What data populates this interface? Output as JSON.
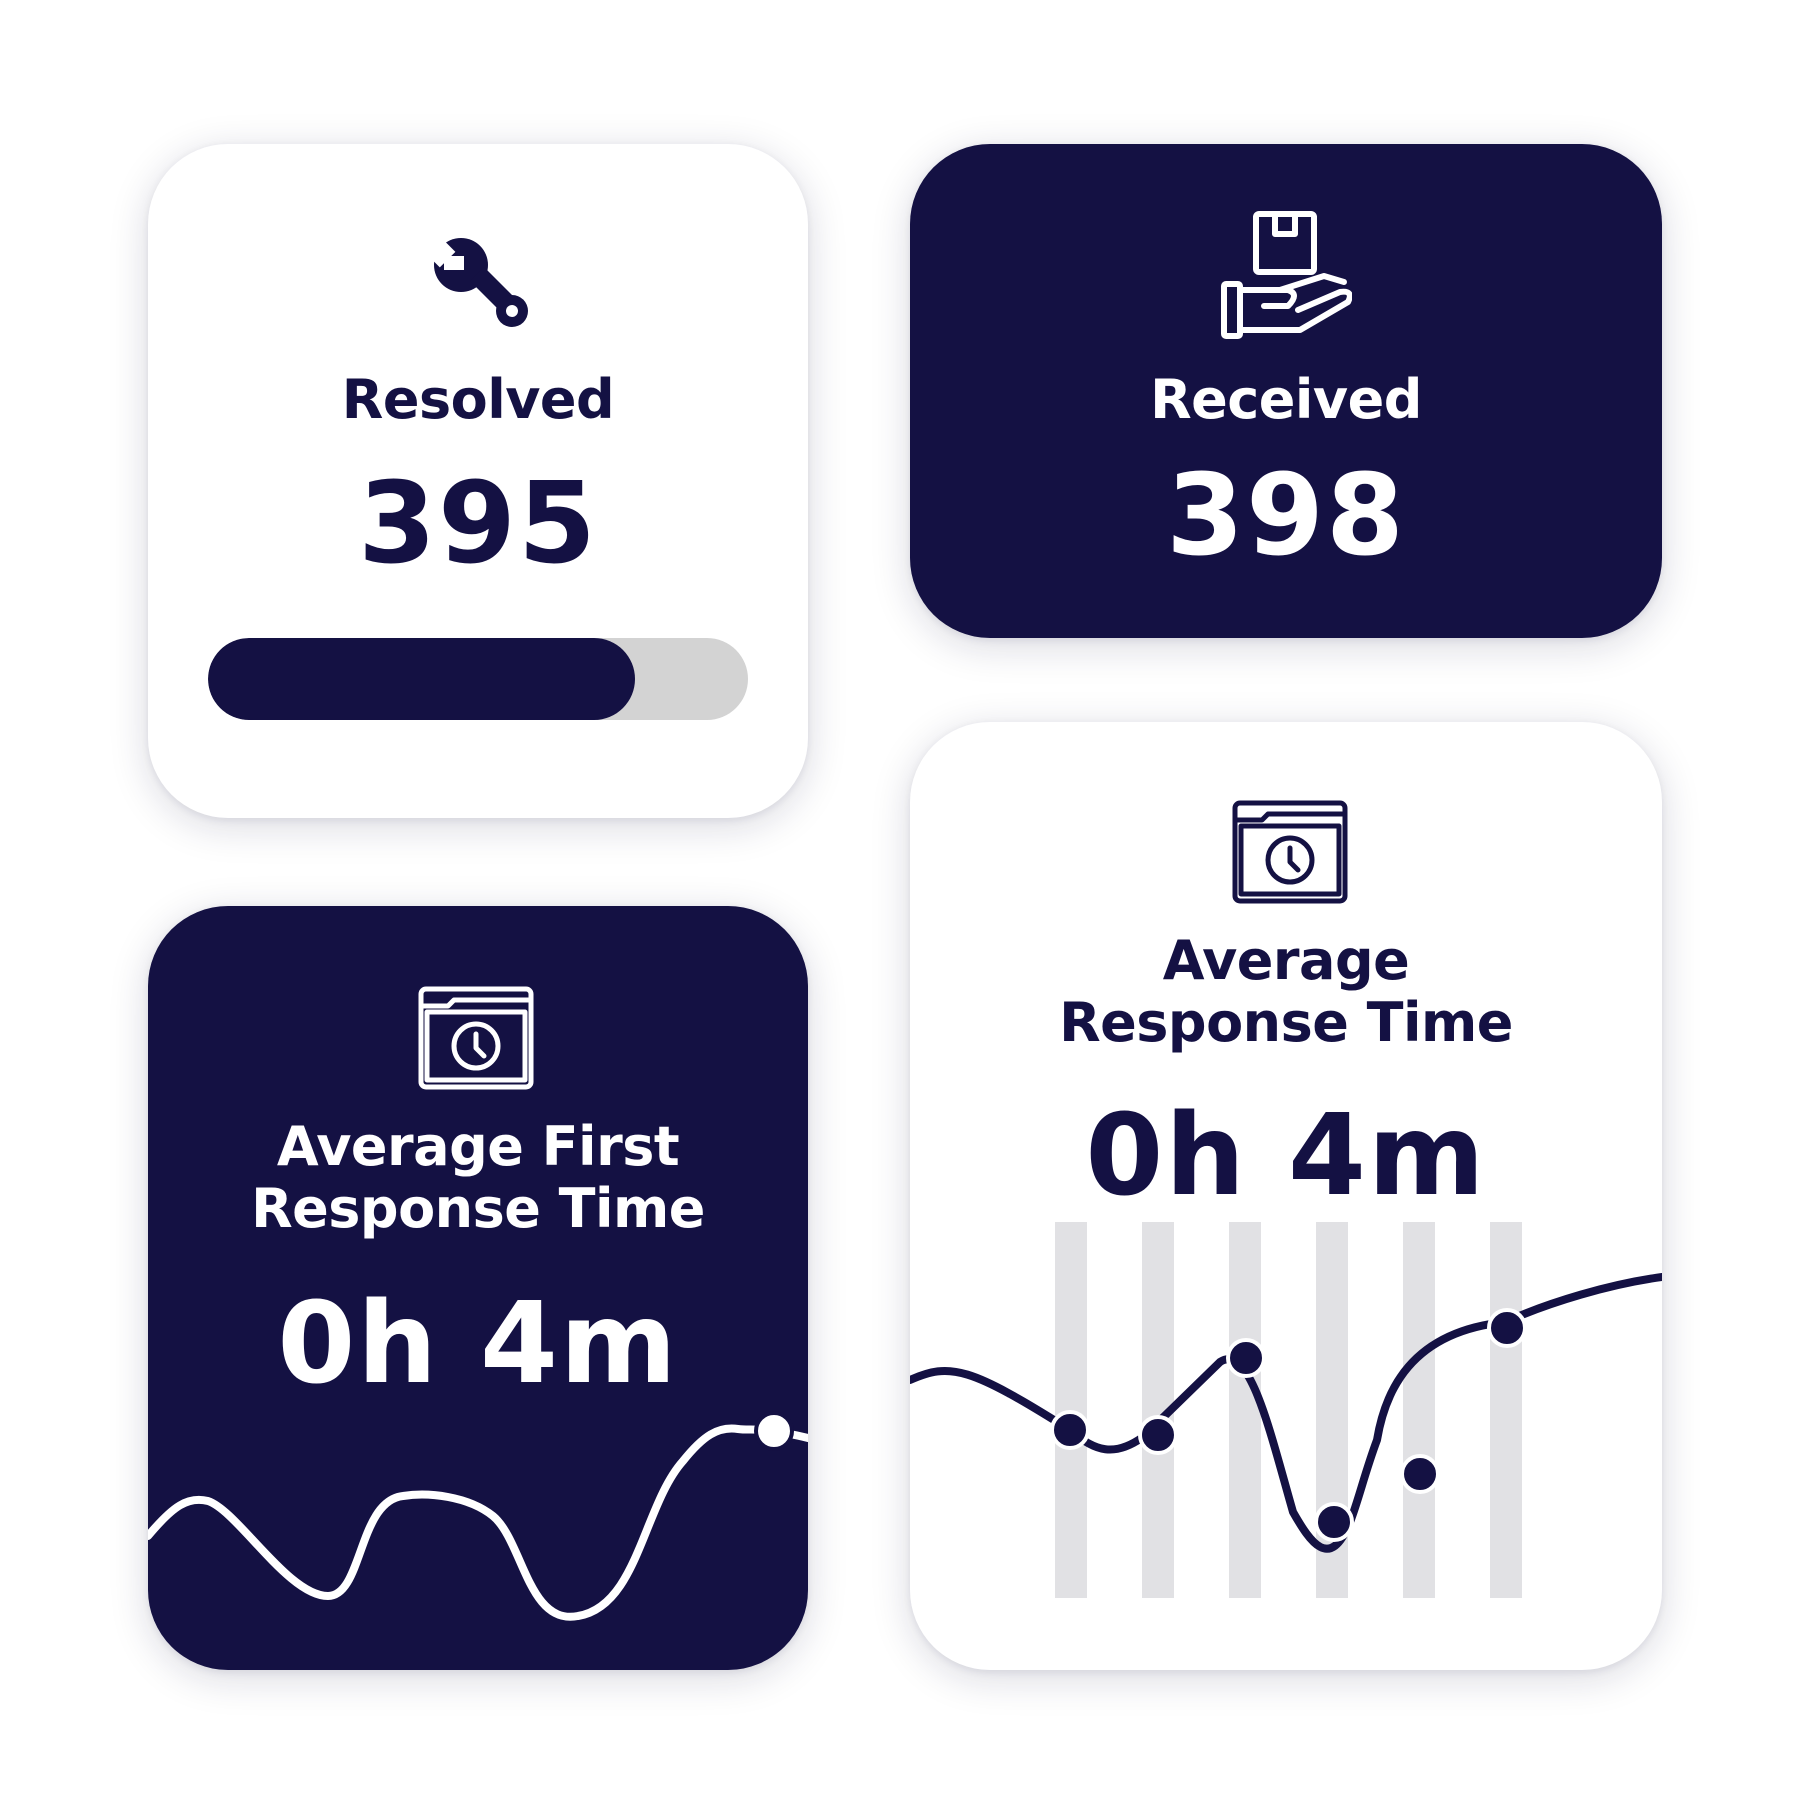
{
  "colors": {
    "navy": "#141143",
    "white": "#ffffff",
    "track": "#d3d3d3",
    "stripe": "#e1e1e4"
  },
  "resolved": {
    "icon": "wrench-icon",
    "label": "Resolved",
    "value": "395",
    "progress_fraction": 0.79
  },
  "received": {
    "icon": "hand-holding-box-icon",
    "label": "Received",
    "value": "398"
  },
  "avg_first_response": {
    "icon": "clock-window-icon",
    "label_line1": "Average First",
    "label_line2": "Response Time",
    "value": "0h 4m"
  },
  "avg_response": {
    "icon": "clock-window-icon",
    "label_line1": "Average",
    "label_line2": "Response Time",
    "value": "0h 4m"
  }
}
